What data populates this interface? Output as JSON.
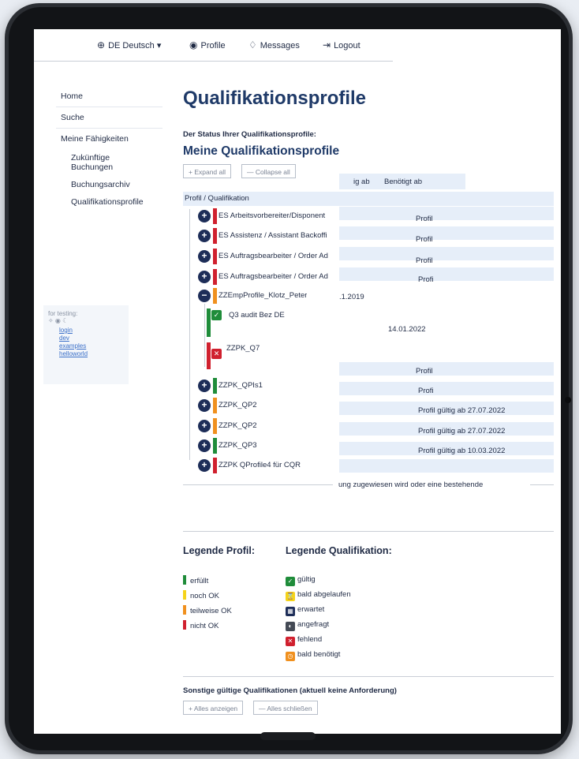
{
  "topbar": {
    "language": "DE Deutsch",
    "profile": "Profile",
    "messages": "Messages",
    "logout": "Logout"
  },
  "sidebar": {
    "items": [
      {
        "label": "Home"
      },
      {
        "label": "Suche"
      },
      {
        "label": "Meine Fähigkeiten"
      }
    ],
    "subitems": [
      {
        "label": "Zukünftige Buchungen"
      },
      {
        "label": "Buchungsarchiv"
      },
      {
        "label": "Qualifikationsprofile"
      }
    ],
    "testing": {
      "label": "for testing:",
      "links": [
        "login",
        "dev",
        "examples",
        "helloworld"
      ]
    }
  },
  "main": {
    "title": "Qualifikationsprofile",
    "status_label": "Der Status Ihrer Qualifikationsprofile:",
    "section_title": "Meine Qualifikationsprofile",
    "expand_all": "+ Expand all",
    "collapse_all": "— Collapse all",
    "col_profile": "Profil / Qualifikation",
    "col_valid": "ig ab",
    "col_needed": "Benötigt ab"
  },
  "rows": [
    {
      "label": "ES Arbeitsvorbereiter/Disponent",
      "right": "Profil",
      "color": "#d0202e"
    },
    {
      "label": "ES Assistenz / Assistant Backoffi",
      "right": "Profil",
      "color": "#d0202e"
    },
    {
      "label": "ES Auftragsbearbeiter / Order Ad",
      "right": "Profil",
      "color": "#d0202e"
    },
    {
      "label": "ES Auftragsbearbeiter / Order Ad",
      "right": "Profi",
      "color": "#d0202e"
    },
    {
      "label": "ZZEmpProfile_Klotz_Peter",
      "date": ".1.2019",
      "color": "#f0901e"
    },
    {
      "label": "Q3 audit Bez DE",
      "date": "14.01.2022"
    },
    {
      "label": "ZZPK_Q7"
    },
    {
      "label": "",
      "right": "Profil"
    },
    {
      "label": "ZZPK_QPIs1",
      "right": "Profi",
      "color": "#1f8c3a"
    },
    {
      "label": "ZZPK_QP2",
      "right": "Profil gültig ab 27.07.2022",
      "color": "#f0901e"
    },
    {
      "label": "ZZPK_QP2",
      "right": "Profil gültig ab 27.07.2022",
      "color": "#f0901e"
    },
    {
      "label": "ZZPK_QP3",
      "right": "Profil gültig ab 10.03.2022",
      "color": "#1f8c3a"
    },
    {
      "label": "ZZPK QProfile4 für CQR",
      "color": "#d0202e"
    }
  ],
  "note": "ung zugewiesen wird oder eine bestehende",
  "legend_profile": {
    "title": "Legende Profil:",
    "items": [
      {
        "label": "erfüllt",
        "color": "#1f8c3a"
      },
      {
        "label": "noch OK",
        "color": "#f5d31a"
      },
      {
        "label": "teilweise OK",
        "color": "#f0901e"
      },
      {
        "label": "nicht OK",
        "color": "#d0202e"
      }
    ]
  },
  "legend_qual": {
    "title": "Legende Qualifikation:",
    "items": [
      {
        "label": "gültig",
        "icon": "check-icon",
        "color": "#1f8c3a"
      },
      {
        "label": "bald abgelaufen",
        "icon": "hourglass-icon",
        "color": "#f5d31a"
      },
      {
        "label": "erwartet",
        "icon": "calendar-icon",
        "color": "#1d2d58"
      },
      {
        "label": "angefragt",
        "icon": "half-circle-icon",
        "color": "#444a55"
      },
      {
        "label": "fehlend",
        "icon": "cross-icon",
        "color": "#d0202e"
      },
      {
        "label": "bald benötigt",
        "icon": "clock-icon",
        "color": "#f0901e"
      }
    ]
  },
  "other": {
    "title": "Sonstige gültige Qualifikationen (aktuell keine Anforderung)",
    "show_all": "+ Alles anzeigen",
    "close_all": "— Alles schließen"
  }
}
